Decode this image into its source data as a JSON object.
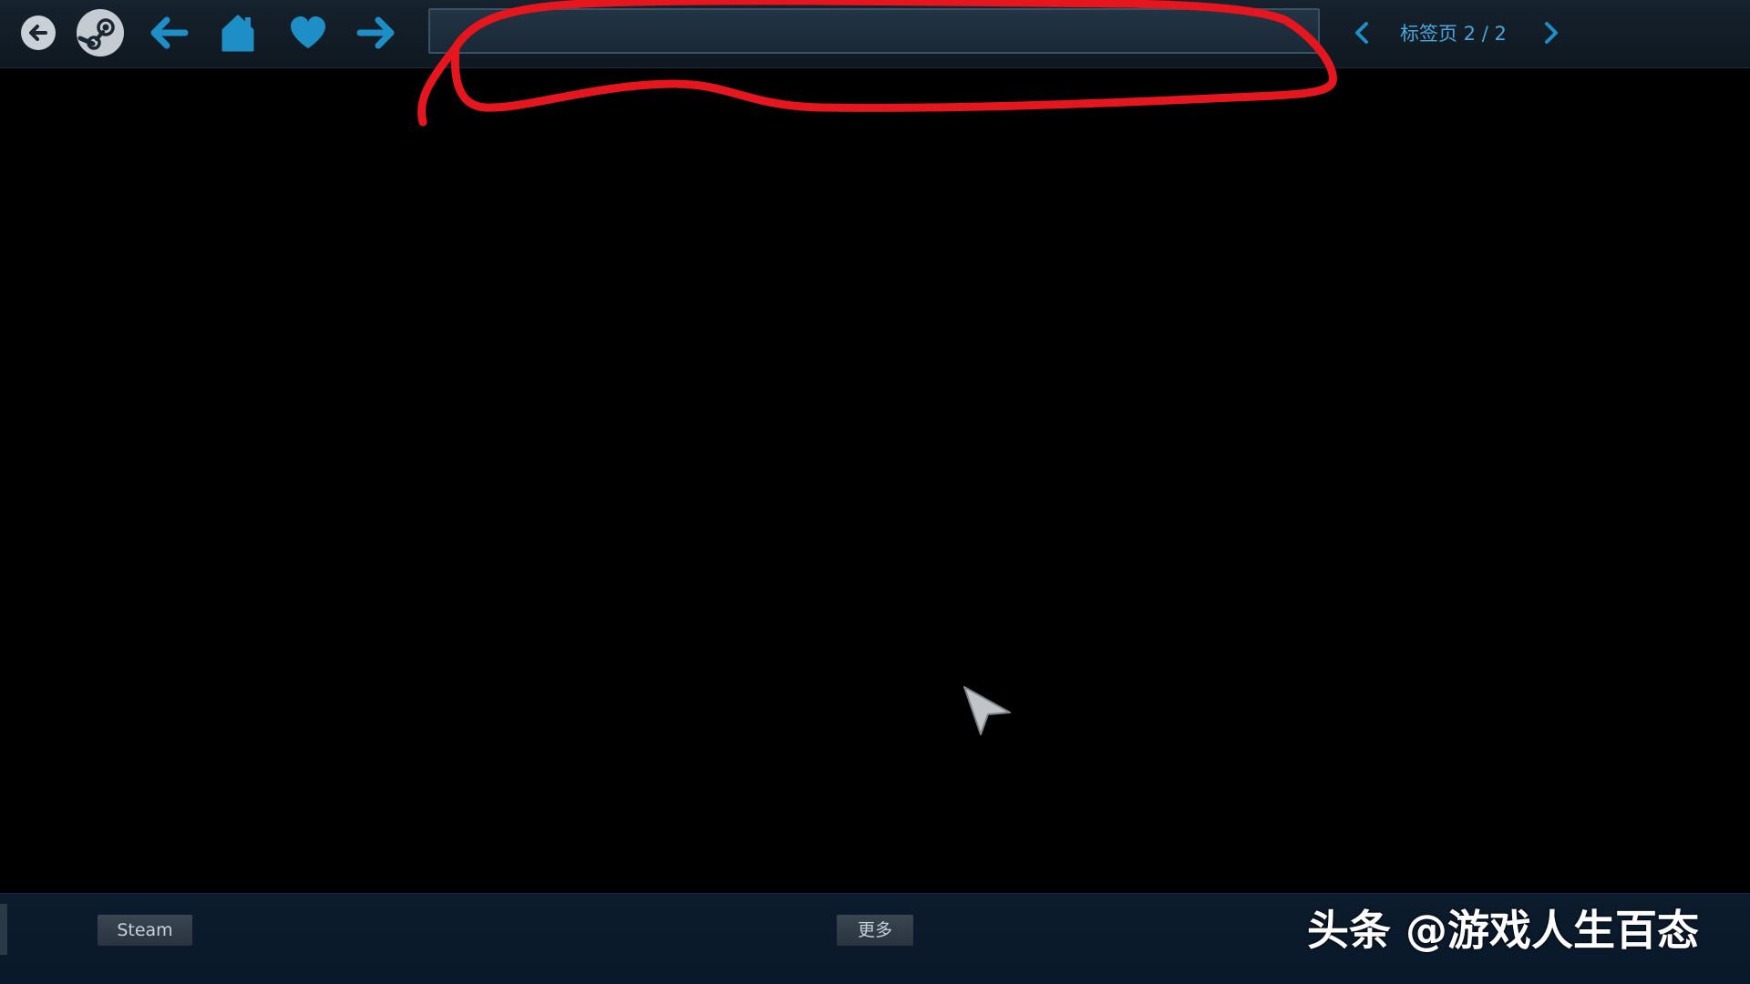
{
  "colors": {
    "toolbar_bg": "#16222e",
    "accent": "#1d8fc6",
    "tab_text": "#4aa6dc",
    "annotation": "#e5161e",
    "bottombar_bg": "#0c1c2d"
  },
  "toolbar": {
    "exit_icon": "circle-back-arrow-icon",
    "steam_icon": "steam-logo-icon",
    "back_icon": "arrow-left-icon",
    "home_icon": "home-icon",
    "favorite_icon": "heart-icon",
    "forward_icon": "arrow-right-icon",
    "url_value": ""
  },
  "tabs": {
    "label": "标签页 2 / 2",
    "prev_icon": "chevron-left-icon",
    "next_icon": "chevron-right-icon"
  },
  "bottom_bar": {
    "steam_label": "Steam",
    "more_label": "更多"
  },
  "watermark": {
    "platform": "头条",
    "author": "@游戏人生百态"
  }
}
